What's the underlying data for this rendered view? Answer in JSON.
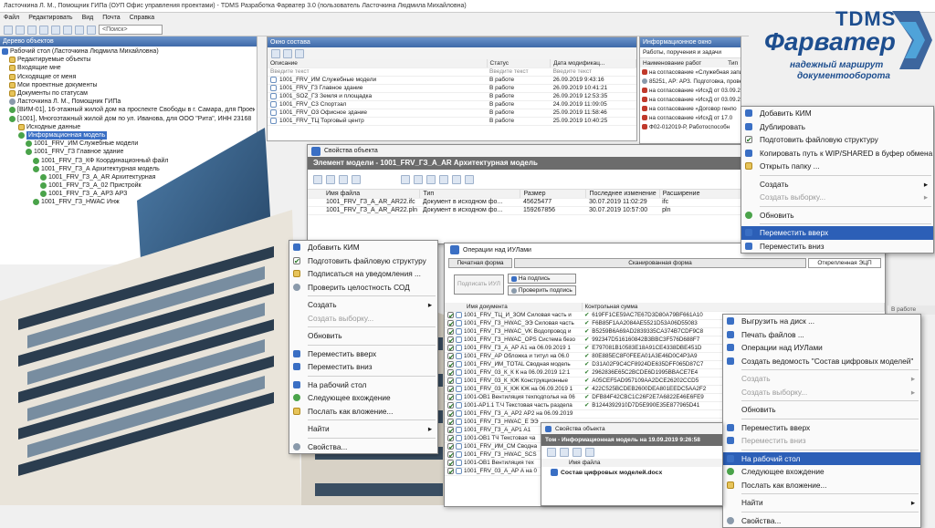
{
  "window": {
    "title": "Ласточкина Л. М., Помощник ГИПа (ОУП Офис управления проектами) - TDMS Разработка Фарватер 3.0 (пользователь Ласточкина Людмила Михайловна)"
  },
  "menubar": [
    "Файл",
    "Редактировать",
    "Вид",
    "Почта",
    "Справка"
  ],
  "search": {
    "placeholder": "<Поиск>"
  },
  "tree": {
    "title": "Дерево объектов",
    "items": [
      "Рабочий стол (Ласточкина Людмила Михайловна)",
      "Редактируемые объекты",
      "Входящие мне",
      "Исходящие от меня",
      "Мои проектные документы",
      "Документы по статусам",
      "Ласточкина Л. М., Помощник ГИПа",
      "[ВИМ-01], 16-этажный жилой дом на проспекте Свободы в г. Самара, для Проек",
      "[1001], Многоэтажный жилой дом по ул. Иванова, для ООО \"Рита\", ИНН 23168",
      "Исходные данные",
      "Информационная модель",
      "1001_FRV_ИМ Служебные модели",
      "1001_FRV_ГЗ Главное здание",
      "1001_FRV_ГЗ_КФ Координационный файл",
      "1001_FRV_ГЗ_А Архитектурная модель",
      "1001_FRV_ГЗ_А_AR Архитектурная",
      "1001_FRV_ГЗ_А_02 Пристройк",
      "1001_FRV_ГЗ_А_АРЗ АРЗ",
      "1001_FRV_ГЗ_HWAC Инж"
    ]
  },
  "objwin": {
    "title": "Окно состава",
    "columns": [
      "Описание",
      "Статус",
      "Дата модификац..."
    ],
    "filter": "Введите текст",
    "rows": [
      [
        "1001_FRV_ИМ Служебные модели",
        "В работе",
        "26.09.2019 9:43:16"
      ],
      [
        "1001_FRV_ГЗ Главное здание",
        "В работе",
        "26.09.2019 10:41:21"
      ],
      [
        "1001_SOZ_ГЗ Земля и площадка",
        "В работе",
        "26.09.2019 12:53:35"
      ],
      [
        "1001_FRV_С3 Спортзал",
        "В работе",
        "24.09.2019 11:09:05"
      ],
      [
        "1001_FRV_О3 Офисное здание",
        "В работе",
        "25.09.2019 11:58:46"
      ],
      [
        "1001_FRV_ТЦ Торговый центр",
        "В работе",
        "25.09.2019 10:40:25"
      ]
    ]
  },
  "infowin": {
    "title": "Информационное окно",
    "subtitle": "Работы, поручения и задачи",
    "columns": [
      "Наименование работ",
      "Тип"
    ],
    "rows": [
      "на согласование «Служебная записка от 2",
      "85251, АР: АРЗ. Подготовка, проверка и вы",
      "на согласование «ИсхД от 03.09.2018, РиК",
      "на согласование «ИсхД от 03.09.2018, РиК",
      "на согласование «Договор генпо",
      "на согласование «ИсхД от 17.0",
      "Ф02-012019-Р, Работоспособн"
    ]
  },
  "logo": {
    "brand_top": "TDMS",
    "brand_main": "Фарватер",
    "tagline_1": "надежный маршрут",
    "tagline_2": "документооборота"
  },
  "propwin": {
    "title": "Свойства объекта",
    "header": "Элемент модели - 1001_FRV_ГЗ_А_AR  Архитектурная модель",
    "columns": [
      "Имя файла",
      "Тип",
      "Размер",
      "Последнее изменение",
      "Расширение"
    ],
    "rows": [
      [
        "1001_FRV_ГЗ_А_AR_AR22.ifc",
        "Документ в исходном фо...",
        "45625477",
        "30.07.2019 11:02:29",
        "ifc"
      ],
      [
        "1001_FRV_ГЗ_А_AR_AR22.pln",
        "Документ в исходном фо...",
        "159267856",
        "30.07.2019 10:57:00",
        "pln"
      ]
    ]
  },
  "ops": {
    "title": "Операции над ИУЛами",
    "tabs": [
      "Печатная форма",
      "Сканированная форма",
      "Открепленная ЭЦП"
    ],
    "btn_sign_disabled": "Подписать ИУЛ",
    "btn_to_sign": "На подпись",
    "btn_check": "Проверить подпись",
    "columns": [
      "Имя документа",
      "Контрольная сумма"
    ],
    "rows": [
      [
        "1001_FRV_ТЦ_И_ЗОМ Силовая часть и",
        "619FF1CE59AC7E67D3D80A79BF661A10"
      ],
      [
        "1001_FRV_ГЗ_HWAC_ЭЭ Силовая часть",
        "F6B85F1AA2084AE5521D53A06D55083"
      ],
      [
        "1001_FRV_ГЗ_HWAC_VK Водопровод и",
        "B5259B6A69AD2839335CA374B7CDF9C8"
      ],
      [
        "1001_FRV_ГЗ_HWAC_OPS Система безо",
        "992347D516160842B3BBC3F576D688F7"
      ],
      [
        "1001_FRV_ГЗ_А_АР А1 на 06.09.2019 1",
        "E797081B10583E18A91CE4338DBE451D"
      ],
      [
        "1001_FRV_АР Обложка и титул на 06.0",
        "80E885EC8F0FEEA01A3E46D0C4P3A9"
      ],
      [
        "1001_FRV_ИМ_TOTAL Сводная модель",
        "D31A02F9C4CF8924DE635DFF065D87C7"
      ],
      [
        "1001_FRV_03_К_К К на 06.09.2019 12:1",
        "2962836E65C2BCDE6D1995BBACE7E4"
      ],
      [
        "1001_FRV_03_К_КЖ Конструкционные",
        "A05CEF5AD957109AA2DCE26202CCD5"
      ],
      [
        "1001_FRV_03_К_КЖ КЖ на 06.09.2019 1",
        "422C525BCDEB2600DEA801EEDC5AA2F2"
      ],
      [
        "1001-ОВ1 Вентиляция техподполья на 06",
        "DFB84F42CBC1C26F2E7A6822E46E6FE9"
      ],
      [
        "1001-АР1.1 Т.Ч Текстовая часть раздела",
        "B1244392910D7D5E990E35E877965D41"
      ],
      [
        "1001_FRV_ГЗ_А_АР2 АР2 на 06.09.2019",
        ""
      ],
      [
        "1001_FRV_ГЗ_HWAC_E ЭЭ",
        ""
      ],
      [
        "1001_FRV_ГЗ_А_АР1 А1",
        ""
      ],
      [
        "1001-ОВ1 ТЧ Текстовая ча",
        ""
      ],
      [
        "1001_FRV_ИМ_СМ Сводна",
        ""
      ],
      [
        "1001_FRV_ГЗ_HWAC_SCS",
        ""
      ],
      [
        "1001-ОВ1 Вентиляция тех",
        ""
      ],
      [
        "1001_FRV_03_А_АР А на 0",
        ""
      ]
    ]
  },
  "menu_top": {
    "items": [
      "Добавить КИМ",
      "Дублировать",
      "Подготовить файловую структуру",
      "Копировать путь к WIP/SHARED в буфер обмена",
      "Открыть папку ...",
      "Создать",
      "Создать выборку...",
      "Обновить",
      "Переместить вверх",
      "Переместить вниз"
    ],
    "status": "В работе"
  },
  "menu_left": {
    "items": [
      "Добавить КИМ",
      "Подготовить файловую структуру",
      "Подписаться на уведомления ...",
      "Проверить целостность СОД",
      "Создать",
      "Создать выборку...",
      "Обновить",
      "Переместить вверх",
      "Переместить вниз",
      "На рабочий стол",
      "Следующее вхождение",
      "Послать как вложение...",
      "Найти",
      "Свойства..."
    ]
  },
  "menu_right": {
    "items": [
      "Выгрузить на диск ...",
      "Печать файлов ...",
      "Операции над ИУЛами",
      "Создать ведомость \"Состав цифровых моделей\"",
      "Создать",
      "Создать выборку...",
      "Обновить",
      "Переместить вверх",
      "Переместить вниз",
      "На рабочий стол",
      "Следующее вхождение",
      "Послать как вложение...",
      "Найти",
      "Свойства..."
    ]
  },
  "props2": {
    "title": "Свойства объекта",
    "header": "Том - Информационная модель на 19.09.2019 9:26:58",
    "column": "Имя файла",
    "file": "Состав цифровых моделей.docx"
  },
  "colors": {
    "accent": "#2c5fb7",
    "logo_blue": "#1d4e8f",
    "header_grey": "#6c6c6c"
  }
}
